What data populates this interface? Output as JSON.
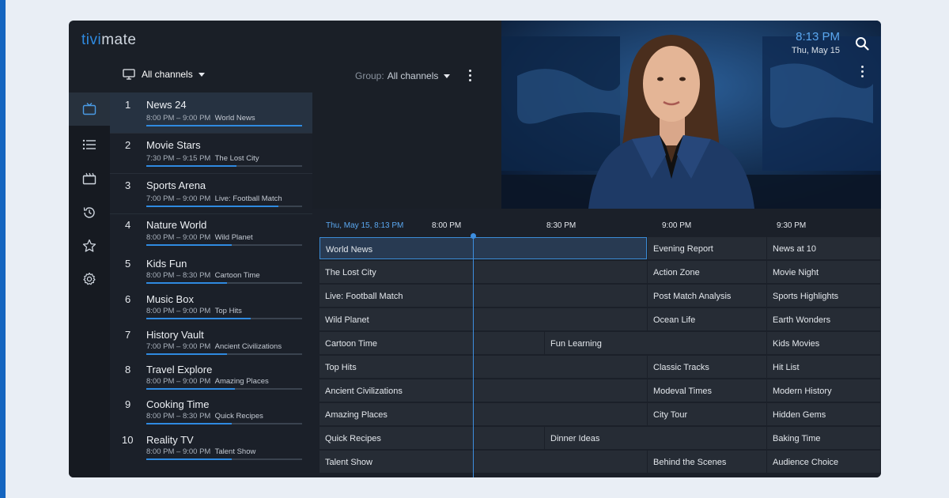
{
  "app": {
    "logo_prefix": "tivi",
    "logo_suffix": "mate"
  },
  "clock": {
    "time": "8:13 PM",
    "date": "Thu, May 15"
  },
  "filter": {
    "label": "All channels"
  },
  "group": {
    "label": "Group:",
    "value": "All channels"
  },
  "sidebar": {
    "items": [
      {
        "icon": "tv-icon",
        "active": true
      },
      {
        "icon": "list-icon",
        "active": false
      },
      {
        "icon": "clapperboard-icon",
        "active": false
      },
      {
        "icon": "history-icon",
        "active": false
      },
      {
        "icon": "star-icon",
        "active": false
      },
      {
        "icon": "gear-icon",
        "active": false
      }
    ]
  },
  "channels": [
    {
      "num": "1",
      "name": "News 24",
      "time": "8:00 PM – 9:00 PM",
      "program": "World News",
      "progress": 1.0,
      "active": true
    },
    {
      "num": "2",
      "name": "Movie Stars",
      "time": "7:30 PM – 9:15 PM",
      "program": "The Lost City",
      "progress": 0.58
    },
    {
      "num": "3",
      "name": "Sports Arena",
      "time": "7:00 PM – 9:00 PM",
      "program": "Live: Football Match",
      "progress": 0.85
    },
    {
      "num": "4",
      "name": "Nature World",
      "time": "8:00 PM – 9:00 PM",
      "program": "Wild Planet",
      "progress": 0.55
    },
    {
      "num": "5",
      "name": "Kids Fun",
      "time": "8:00 PM – 8:30 PM",
      "program": "Cartoon Time",
      "progress": 0.52
    },
    {
      "num": "6",
      "name": "Music Box",
      "time": "8:00 PM – 9:00 PM",
      "program": "Top Hits",
      "progress": 0.67
    },
    {
      "num": "7",
      "name": "History Vault",
      "time": "7:00 PM – 9:00 PM",
      "program": "Ancient Civilizations",
      "progress": 0.52
    },
    {
      "num": "8",
      "name": "Travel Explore",
      "time": "8:00 PM – 9:00 PM",
      "program": "Amazing Places",
      "progress": 0.57
    },
    {
      "num": "9",
      "name": "Cooking Time",
      "time": "8:00 PM – 8:30 PM",
      "program": "Quick Recipes",
      "progress": 0.55
    },
    {
      "num": "10",
      "name": "Reality TV",
      "time": "8:00 PM – 9:00 PM",
      "program": "Talent Show",
      "progress": 0.55
    }
  ],
  "epg": {
    "now_label": "Thu, May 15, 8:13 PM",
    "times": [
      "8:00 PM",
      "8:30 PM",
      "9:00 PM",
      "9:30 PM"
    ],
    "rows": [
      [
        "World News",
        "Evening Report",
        "News at 10"
      ],
      [
        "The Lost City",
        "Action Zone",
        "Movie Night"
      ],
      [
        "Live: Football Match",
        "Post Match Analysis",
        "Sports Highlights"
      ],
      [
        "Wild Planet",
        "Ocean Life",
        "Earth Wonders"
      ],
      [
        "Cartoon Time",
        "Fun Learning",
        "Kids Movies"
      ],
      [
        "Top Hits",
        "Classic Tracks",
        "Hit List"
      ],
      [
        "Ancient Civilizations",
        "Modeval Times",
        "Modern History"
      ],
      [
        "Amazing Places",
        "City Tour",
        "Hidden Gems"
      ],
      [
        "Quick Recipes",
        "Dinner Ideas",
        "Baking Time"
      ],
      [
        "Talent Show",
        "Behind the Scenes",
        "Audience Choice"
      ]
    ]
  },
  "colors": {
    "accent": "#2f8ae0",
    "background": "#1a1f27",
    "selected_cell": "#283a52"
  }
}
